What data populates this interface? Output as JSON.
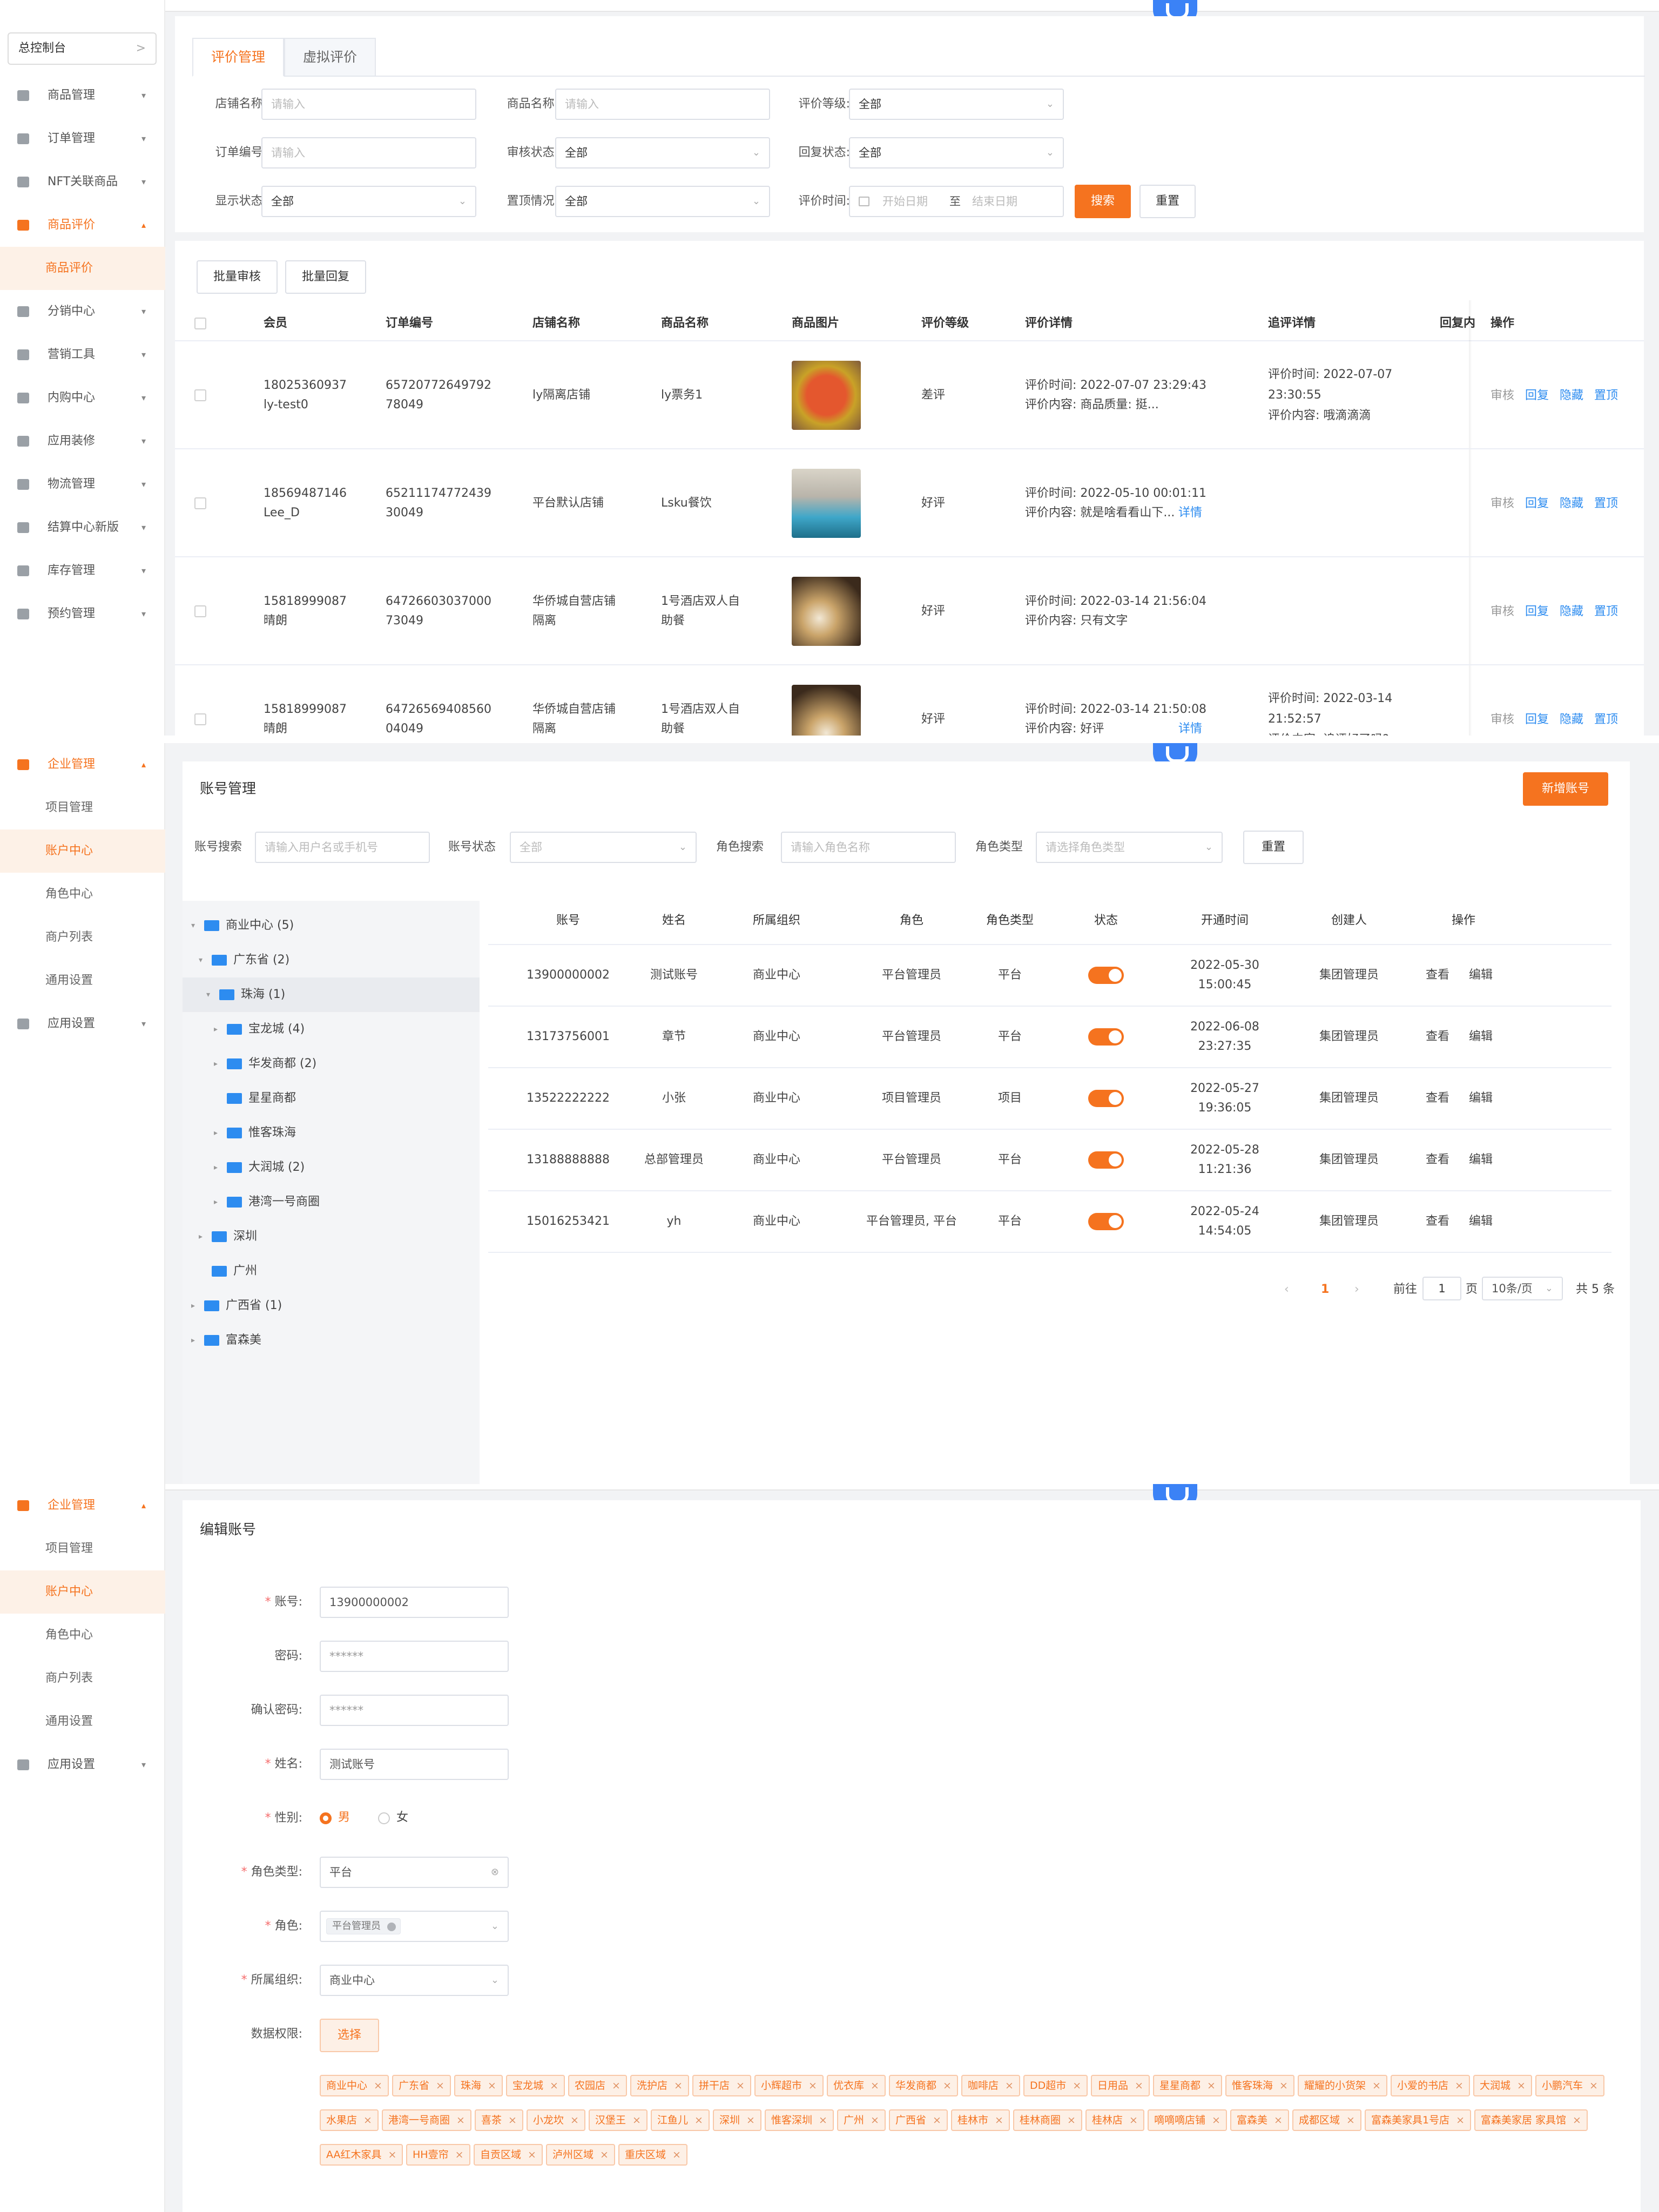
{
  "panel1": {
    "sidebar": {
      "top_label": "总控制台",
      "top_chevron": ">",
      "items": [
        {
          "label": "商品管理",
          "caret": "▾"
        },
        {
          "label": "订单管理",
          "caret": "▾"
        },
        {
          "label": "NFT关联商品",
          "caret": "▾"
        },
        {
          "label": "商品评价",
          "caret": "▴"
        },
        {
          "label": "商品评价",
          "caret": ""
        },
        {
          "label": "分销中心",
          "caret": "▾"
        },
        {
          "label": "营销工具",
          "caret": "▾"
        },
        {
          "label": "内购中心",
          "caret": "▾"
        },
        {
          "label": "应用装修",
          "caret": "▾"
        },
        {
          "label": "物流管理",
          "caret": "▾"
        },
        {
          "label": "结算中心新版",
          "caret": "▾"
        },
        {
          "label": "库存管理",
          "caret": "▾"
        },
        {
          "label": "预约管理",
          "caret": "▾"
        }
      ]
    },
    "tabs": [
      "评价管理",
      "虚拟评价"
    ],
    "filters": {
      "shop_label": "店铺名称:",
      "shop_ph": "请输入",
      "goods_label": "商品名称:",
      "goods_ph": "请输入",
      "level_label": "评价等级:",
      "level_val": "全部",
      "order_label": "订单编号:",
      "order_ph": "请输入",
      "audit_label": "审核状态:",
      "audit_val": "全部",
      "reply_label": "回复状态:",
      "reply_val": "全部",
      "show_label": "显示状态:",
      "show_val": "全部",
      "top_label": "置顶情况:",
      "top_val": "全部",
      "time_label": "评价时间:",
      "start_ph": "开始日期",
      "to": "至",
      "end_ph": "结束日期",
      "search": "搜索",
      "reset": "重置"
    },
    "batch": {
      "audit": "批量审核",
      "reply": "批量回复"
    },
    "columns": [
      "会员",
      "订单编号",
      "店铺名称",
      "商品名称",
      "商品图片",
      "评价等级",
      "评价详情",
      "追评详情",
      "回复内",
      "操作"
    ],
    "rows": [
      {
        "member": "18025360937",
        "member2": "ly-test0",
        "order": "65720772649792",
        "order2": "78049",
        "shop": "ly隔离店铺",
        "shop2": "",
        "goods": "ly票务1",
        "goods2": "",
        "level": "差评",
        "d1": "评价时间: 2022-07-07 23:29:43",
        "d2": "评价内容: 商品质量: 挺...",
        "more": "",
        "f1": "评价时间: 2022-07-07",
        "f2": "23:30:55",
        "f3": "评价内容: 哦滴滴滴"
      },
      {
        "member": "18569487146",
        "member2": "Lee_D",
        "order": "65211174772439",
        "order2": "30049",
        "shop": "平台默认店铺",
        "shop2": "",
        "goods": "Lsku餐饮",
        "goods2": "",
        "level": "好评",
        "d1": "评价时间: 2022-05-10 00:01:11",
        "d2": "评价内容: 就是啥看看山下...",
        "more": "详情",
        "f1": "",
        "f2": "",
        "f3": ""
      },
      {
        "member": "15818999087",
        "member2": "晴朗",
        "order": "64726603037000",
        "order2": "73049",
        "shop": "华侨城自营店铺",
        "shop2": "隔离",
        "goods": "1号酒店双人自",
        "goods2": "助餐",
        "level": "好评",
        "d1": "评价时间: 2022-03-14 21:56:04",
        "d2": "评价内容: 只有文字",
        "more": "",
        "f1": "",
        "f2": "",
        "f3": ""
      },
      {
        "member": "15818999087",
        "member2": "晴朗",
        "order": "64726569408560",
        "order2": "04049",
        "shop": "华侨城自营店铺",
        "shop2": "隔离",
        "goods": "1号酒店双人自",
        "goods2": "助餐",
        "level": "好评",
        "d1": "评价时间: 2022-03-14 21:50:08",
        "d2": "评价内容: 好评",
        "more": "详情",
        "f1": "评价时间: 2022-03-14",
        "f2": "21:52:57",
        "f3": "评价内容: 追评好了吗?"
      }
    ],
    "ops": [
      "审核",
      "回复",
      "隐藏",
      "置顶"
    ]
  },
  "panel2": {
    "sidebar": [
      {
        "label": "企业管理",
        "caret": "▴"
      },
      {
        "label": "项目管理"
      },
      {
        "label": "账户中心"
      },
      {
        "label": "角色中心"
      },
      {
        "label": "商户列表"
      },
      {
        "label": "通用设置"
      },
      {
        "label": "应用设置",
        "caret": "▾"
      }
    ],
    "title": "账号管理",
    "add": "新增账号",
    "filters": {
      "acc_label": "账号搜索",
      "acc_ph": "请输入用户名或手机号",
      "status_label": "账号状态",
      "status_val": "全部",
      "role_label": "角色搜索",
      "role_ph": "请输入角色名称",
      "type_label": "角色类型",
      "type_ph": "请选择角色类型",
      "reset": "重置"
    },
    "tree": [
      {
        "label": "商业中心 (5)",
        "tri": "▾"
      },
      {
        "label": "广东省 (2)",
        "tri": "▾"
      },
      {
        "label": "珠海 (1)",
        "tri": "▾"
      },
      {
        "label": "宝龙城 (4)",
        "tri": "▸"
      },
      {
        "label": "华发商都 (2)",
        "tri": "▸"
      },
      {
        "label": "星星商都",
        "tri": ""
      },
      {
        "label": "惟客珠海",
        "tri": "▸"
      },
      {
        "label": "大润城 (2)",
        "tri": "▸"
      },
      {
        "label": "港湾一号商圈",
        "tri": "▸"
      },
      {
        "label": "深圳",
        "tri": "▸"
      },
      {
        "label": "广州",
        "tri": ""
      },
      {
        "label": "广西省 (1)",
        "tri": "▸"
      },
      {
        "label": "富森美",
        "tri": "▸"
      }
    ],
    "columns": [
      "账号",
      "姓名",
      "所属组织",
      "角色",
      "角色类型",
      "状态",
      "开通时间",
      "创建人",
      "操作"
    ],
    "rows": [
      {
        "acc": "13900000002",
        "name": "测试账号",
        "org": "商业中心",
        "role": "平台管理员",
        "type": "平台",
        "date": "2022-05-30",
        "time": "15:00:45",
        "creator": "集团管理员"
      },
      {
        "acc": "13173756001",
        "name": "章节",
        "org": "商业中心",
        "role": "平台管理员",
        "type": "平台",
        "date": "2022-06-08",
        "time": "23:27:35",
        "creator": "集团管理员"
      },
      {
        "acc": "13522222222",
        "name": "小张",
        "org": "商业中心",
        "role": "项目管理员",
        "type": "项目",
        "date": "2022-05-27",
        "time": "19:36:05",
        "creator": "集团管理员"
      },
      {
        "acc": "13188888888",
        "name": "总部管理员",
        "org": "商业中心",
        "role": "平台管理员",
        "type": "平台",
        "date": "2022-05-28",
        "time": "11:21:36",
        "creator": "集团管理员"
      },
      {
        "acc": "15016253421",
        "name": "yh",
        "org": "商业中心",
        "role": "平台管理员, 平台",
        "type": "平台",
        "date": "2022-05-24",
        "time": "14:54:05",
        "creator": "集团管理员"
      }
    ],
    "ops": [
      "查看",
      "编辑"
    ],
    "pager": {
      "prev": "‹",
      "page": "1",
      "next": "›",
      "goto": "前往",
      "goto_val": "1",
      "page_unit": "页",
      "size": "10条/页",
      "total": "共 5 条"
    }
  },
  "panel3": {
    "sidebar": [
      {
        "label": "企业管理",
        "caret": "▴"
      },
      {
        "label": "项目管理"
      },
      {
        "label": "账户中心"
      },
      {
        "label": "角色中心"
      },
      {
        "label": "商户列表"
      },
      {
        "label": "通用设置"
      },
      {
        "label": "应用设置",
        "caret": "▾"
      }
    ],
    "title": "编辑账号",
    "form": {
      "acc_label": "账号:",
      "acc_val": "13900000002",
      "pwd_label": "密码:",
      "pwd_val": "******",
      "cpwd_label": "确认密码:",
      "cpwd_val": "******",
      "name_label": "姓名:",
      "name_val": "测试账号",
      "gender_label": "性别:",
      "male": "男",
      "female": "女",
      "type_label": "角色类型:",
      "type_val": "平台",
      "role_label": "角色:",
      "role_tag": "平台管理员",
      "org_label": "所属组织:",
      "org_val": "商业中心",
      "perm_label": "数据权限:",
      "choose": "选择"
    },
    "tags": [
      "商业中心",
      "广东省",
      "珠海",
      "宝龙城",
      "农园店",
      "洗护店",
      "拼干店",
      "小辉超市",
      "优衣库",
      "华发商都",
      "咖啡店",
      "DD超市",
      "日用品",
      "星星商都",
      "惟客珠海",
      "耀耀的小货架",
      "小爱的书店",
      "大润城",
      "小鹏汽车",
      "水果店",
      "港湾一号商圈",
      "喜茶",
      "小龙坎",
      "汉堡王",
      "江鱼儿",
      "深圳",
      "惟客深圳",
      "广州",
      "广西省",
      "桂林市",
      "桂林商圈",
      "桂林店",
      "嘀嘀嘀店铺",
      "富森美",
      "成都区域",
      "富森美家具1号店",
      "富森美家居 家具馆",
      "AA红木家具",
      "HH壹帘",
      "自贡区域",
      "泸州区域",
      "重庆区域"
    ]
  }
}
